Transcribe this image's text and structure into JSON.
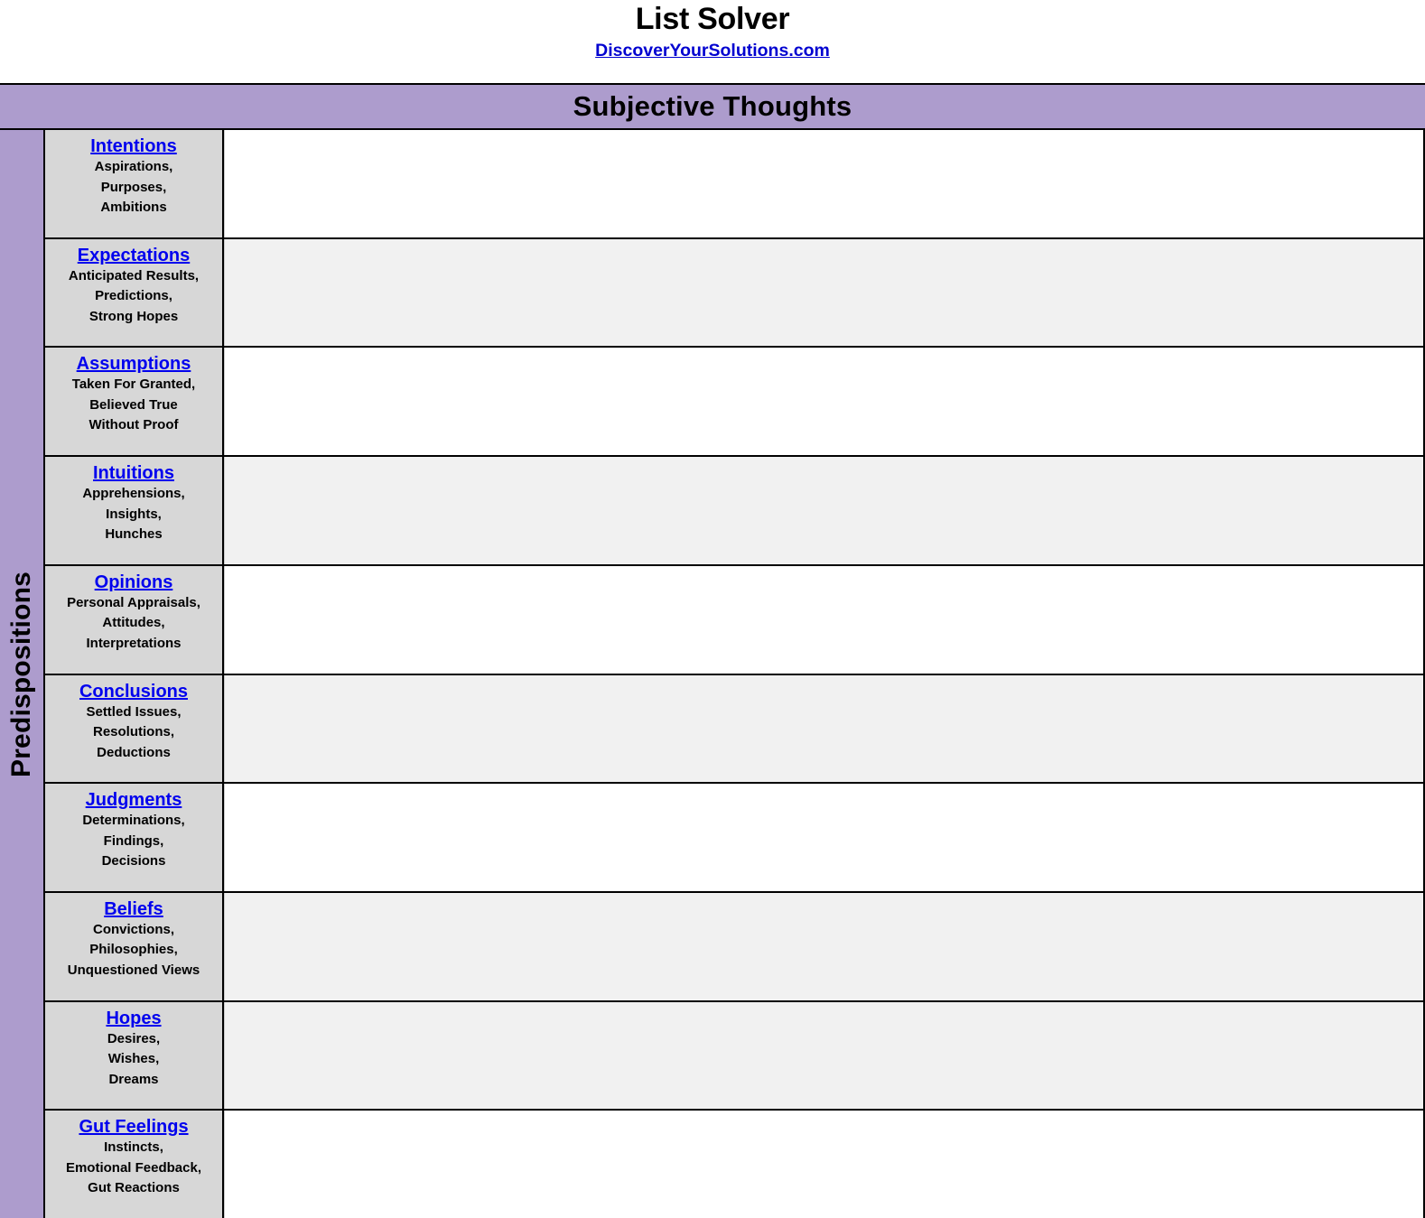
{
  "masthead": {
    "app_title": "List Solver",
    "site_link": "DiscoverYourSolutions.com"
  },
  "banner": {
    "title": "Subjective Thoughts"
  },
  "matrix": {
    "rail_label": "Predispositions",
    "colors": {
      "banner_purple": "#ad9ccd",
      "rail_purple": "#ad9ccd",
      "label_gray": "#d7d7d7",
      "row_white": "#ffffff",
      "row_alt_gray": "#f1f1f1",
      "link_blue": "#0000ee",
      "border_black": "#000000"
    },
    "rows": [
      {
        "term": "Intentions",
        "desc_lines": [
          "Aspirations,",
          "Purposes,",
          "Ambitions"
        ],
        "value": "",
        "shade": "white"
      },
      {
        "term": "Expectations",
        "desc_lines": [
          "Anticipated Results,",
          "Predictions,",
          "Strong Hopes"
        ],
        "value": "",
        "shade": "gray"
      },
      {
        "term": "Assumptions",
        "desc_lines": [
          "Taken For Granted,",
          "Believed True",
          "Without Proof"
        ],
        "value": "",
        "shade": "white"
      },
      {
        "term": "Intuitions",
        "desc_lines": [
          "Apprehensions,",
          "Insights,",
          "Hunches"
        ],
        "value": "",
        "shade": "gray"
      },
      {
        "term": "Opinions",
        "desc_lines": [
          "Personal Appraisals,",
          "Attitudes,",
          "Interpretations"
        ],
        "value": "",
        "shade": "white"
      },
      {
        "term": "Conclusions",
        "desc_lines": [
          "Settled Issues,",
          "Resolutions,",
          "Deductions"
        ],
        "value": "",
        "shade": "gray"
      },
      {
        "term": "Judgments",
        "desc_lines": [
          "Determinations,",
          "Findings,",
          "Decisions"
        ],
        "value": "",
        "shade": "white"
      },
      {
        "term": "Beliefs",
        "desc_lines": [
          "Convictions,",
          "Philosophies,",
          "Unquestioned Views"
        ],
        "value": "",
        "shade": "gray"
      },
      {
        "term": "Hopes",
        "desc_lines": [
          "Desires,",
          "Wishes,",
          "Dreams"
        ],
        "value": "",
        "shade": "gray"
      },
      {
        "term": "Gut Feelings",
        "desc_lines": [
          "Instincts,",
          "Emotional Feedback,",
          "Gut Reactions"
        ],
        "value": "",
        "shade": "white"
      }
    ]
  }
}
